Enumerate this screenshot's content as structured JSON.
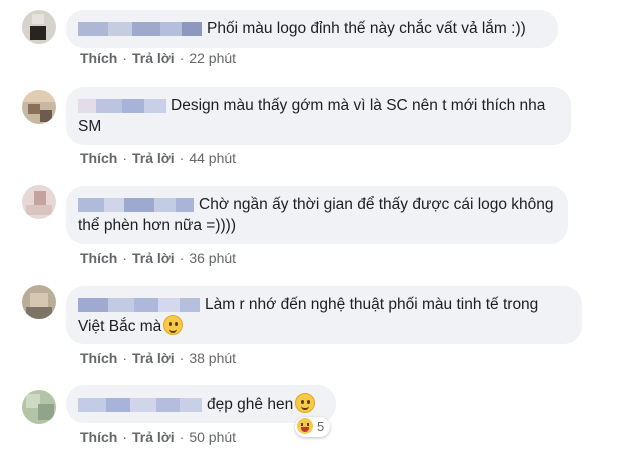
{
  "comments": [
    {
      "text": "Phối màu logo đỉnh thế này chắc vất vả lắm :))",
      "like": "Thích",
      "reply": "Trả lời",
      "time": "22 phút"
    },
    {
      "text": "Design màu thấy gớm mà vì là SC nên t mới thích nha SM",
      "like": "Thích",
      "reply": "Trả lời",
      "time": "44 phút"
    },
    {
      "text": "Chờ ngần ấy thời gian để thấy được cái logo không thể phèn hơn nữa =))))",
      "like": "Thích",
      "reply": "Trả lời",
      "time": "36 phút"
    },
    {
      "text": "Làm r nhớ đến nghệ thuật phối màu tinh tế trong Việt Bắc mà",
      "emoji": "grinning-face",
      "like": "Thích",
      "reply": "Trả lời",
      "time": "38 phút"
    },
    {
      "text": "đẹp ghê hen",
      "emoji": "slightly-smiling-face",
      "like": "Thích",
      "reply": "Trả lời",
      "time": "50 phút",
      "reaction_icon": "laughing-face",
      "reaction_count": "5"
    }
  ],
  "separator": "·"
}
